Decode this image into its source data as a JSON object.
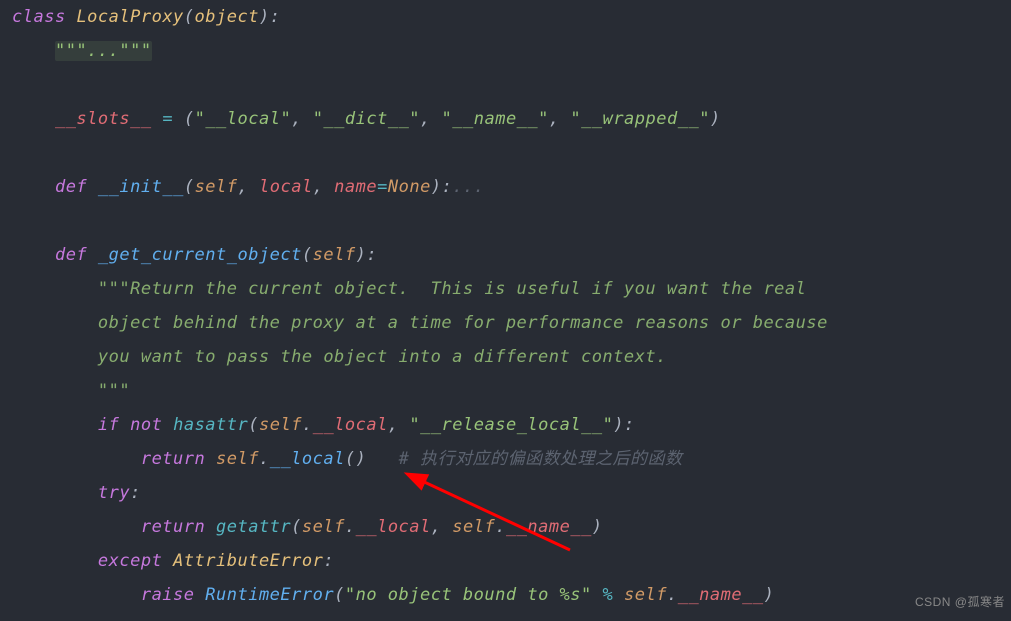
{
  "code": {
    "class_kw": "class",
    "class_name": "LocalProxy",
    "base": "object",
    "docstr_placeholder": "\"\"\"...\"\"\"",
    "slots_name": "__slots__",
    "slot1": "\"__local\"",
    "slot2": "\"__dict__\"",
    "slot3": "\"__name__\"",
    "slot4": "\"__wrapped__\"",
    "def_kw": "def",
    "init_name": "__init__",
    "self": "self",
    "param_local": "local",
    "param_name": "name",
    "none": "None",
    "fold": "...",
    "get_obj_name": "_get_current_object",
    "doc1": "\"\"\"Return the current object.  This is useful if you want the real",
    "doc2": "object behind the proxy at a time for performance reasons or because",
    "doc3": "you want to pass the object into a different context.",
    "doc4": "\"\"\"",
    "if_kw": "if",
    "not_kw": "not",
    "hasattr": "hasattr",
    "attr_local": "__local",
    "str_release": "\"__release_local__\"",
    "return_kw": "return",
    "comment_partial": "# 执行对应的偏函数处理之后的函数",
    "try_kw": "try",
    "getattr": "getattr",
    "attr_name": "__name__",
    "except_kw": "except",
    "attr_error": "AttributeError",
    "raise_kw": "raise",
    "runtime_error": "RuntimeError",
    "err_str": "\"no object bound to %s\"",
    "pct": "%"
  },
  "watermark": "CSDN @孤寒者"
}
